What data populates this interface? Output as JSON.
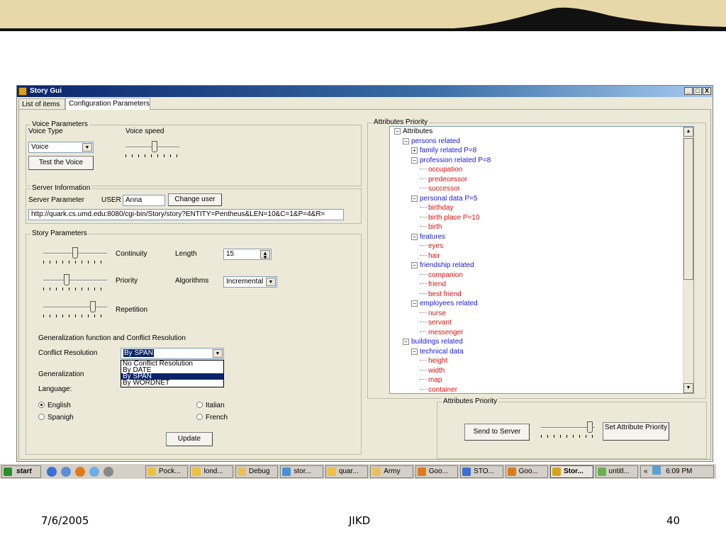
{
  "window": {
    "title": "Story Gui",
    "controls": [
      "_",
      "□",
      "X"
    ]
  },
  "tabs": [
    {
      "label": "List of items"
    },
    {
      "label": "Configuration Parameters"
    }
  ],
  "voice": {
    "group_title": "Voice Parameters",
    "voice_type_label": "Voice Type",
    "voice_speed_label": "Voice speed",
    "voice_type_value": "Voice",
    "test_button": "Test the Voice",
    "voice_speed_level": 0.55
  },
  "server": {
    "group_title": "Server Information",
    "param_label": "Server Parameter",
    "user_label": "USER",
    "user_value": "Anna",
    "change_user_button": "Change user",
    "url_value": "http://quark.cs.umd.edu:8080/cgi-bin/Story/story?ENTITY=Pentheus&LEN=10&C=1&P=4&R="
  },
  "story": {
    "group_title": "Story Parameters",
    "continuity_label": "Continuity",
    "continuity_level": 0.5,
    "length_label": "Length",
    "length_value": "15",
    "priority_label": "Priority",
    "priority_level": 0.35,
    "algorithms_label": "Algorithms",
    "algorithms_value": "Incremental",
    "repetition_label": "Repetition",
    "repetition_level": 0.8,
    "generalization_heading": "Generalization function  and Conflict Resolution",
    "conflict_label": "Conflict Resolution",
    "conflict_value": "By SPAN",
    "conflict_options": [
      "No Conflict Resolution",
      "By DATE",
      "By SPAN",
      "By WORDNET"
    ],
    "conflict_selected_index": 2,
    "generalization_label": "Generalization",
    "language_label": "Language:",
    "languages": [
      {
        "label": "English",
        "checked": true
      },
      {
        "label": "Italian",
        "checked": false
      },
      {
        "label": "Spanigh",
        "checked": false
      },
      {
        "label": "French",
        "checked": false
      }
    ],
    "update_button": "Update"
  },
  "attributes": {
    "group_title": "Attributes Priority",
    "tree": [
      {
        "label": "Attributes",
        "level": 0,
        "expander": "−",
        "color": "black"
      },
      {
        "label": "persons related",
        "level": 1,
        "expander": "−",
        "color": "blue"
      },
      {
        "label": "family related P=8",
        "level": 2,
        "expander": "+",
        "color": "blue"
      },
      {
        "label": "profession related P=8",
        "level": 2,
        "expander": "−",
        "color": "blue"
      },
      {
        "label": "occupation",
        "level": 3,
        "expander": "",
        "color": "red"
      },
      {
        "label": "predecessor",
        "level": 3,
        "expander": "",
        "color": "red"
      },
      {
        "label": "successor",
        "level": 3,
        "expander": "",
        "color": "red"
      },
      {
        "label": "personal data P=5",
        "level": 2,
        "expander": "−",
        "color": "blue"
      },
      {
        "label": "birthday",
        "level": 3,
        "expander": "",
        "color": "red"
      },
      {
        "label": "birth place P=10",
        "level": 3,
        "expander": "",
        "color": "red"
      },
      {
        "label": "birth",
        "level": 3,
        "expander": "",
        "color": "red"
      },
      {
        "label": "features",
        "level": 2,
        "expander": "−",
        "color": "blue"
      },
      {
        "label": "eyes",
        "level": 3,
        "expander": "",
        "color": "red"
      },
      {
        "label": "hair",
        "level": 3,
        "expander": "",
        "color": "red"
      },
      {
        "label": "friendship related",
        "level": 2,
        "expander": "−",
        "color": "blue"
      },
      {
        "label": "companion",
        "level": 3,
        "expander": "",
        "color": "red"
      },
      {
        "label": "friend",
        "level": 3,
        "expander": "",
        "color": "red"
      },
      {
        "label": "best friend",
        "level": 3,
        "expander": "",
        "color": "red"
      },
      {
        "label": "employees related",
        "level": 2,
        "expander": "−",
        "color": "blue"
      },
      {
        "label": "nurse",
        "level": 3,
        "expander": "",
        "color": "red"
      },
      {
        "label": "servant",
        "level": 3,
        "expander": "",
        "color": "red"
      },
      {
        "label": "messenger",
        "level": 3,
        "expander": "",
        "color": "red"
      },
      {
        "label": "buildings related",
        "level": 1,
        "expander": "−",
        "color": "blue"
      },
      {
        "label": "technical data",
        "level": 2,
        "expander": "−",
        "color": "blue"
      },
      {
        "label": "height",
        "level": 3,
        "expander": "",
        "color": "red"
      },
      {
        "label": "width",
        "level": 3,
        "expander": "",
        "color": "red"
      },
      {
        "label": "map",
        "level": 3,
        "expander": "",
        "color": "red"
      },
      {
        "label": "container",
        "level": 3,
        "expander": "",
        "color": "red"
      }
    ],
    "sub_group_title": "Attributes Priority",
    "send_button": "Send to Server",
    "set_priority_button": "Set Attribute Priority",
    "priority_slider_level": 0.95
  },
  "taskbar": {
    "start_label": "start",
    "tasks": [
      "Pock...",
      "lond...",
      "Debug",
      "stor...",
      "quar...",
      "Army",
      "Goo...",
      "STO...",
      "Goo...",
      "Stor...",
      "untitl..."
    ],
    "active_task_index": 9,
    "tray_chevron": "«",
    "clock": "6:09 PM"
  },
  "footer": {
    "date": "7/6/2005",
    "center": "JIKD",
    "page": "40"
  },
  "colors": {
    "tree_blue": "#1a1ae0",
    "tree_red": "#e01010",
    "title_bar": "#0a246a"
  }
}
